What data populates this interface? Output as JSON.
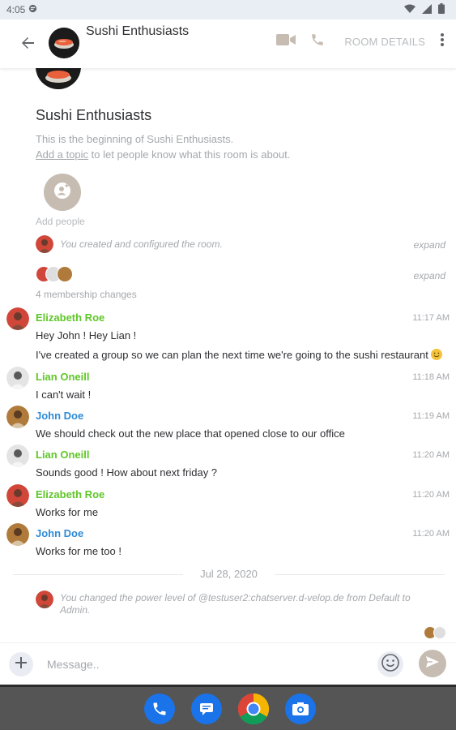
{
  "status_bar": {
    "time": "4:05",
    "icons": [
      "notification-icon",
      "wifi-icon",
      "signal-icon",
      "battery-icon"
    ]
  },
  "header": {
    "room_title": "Sushi Enthusiasts",
    "room_details_label": "ROOM DETAILS",
    "icons": [
      "back-arrow-icon",
      "video-call-icon",
      "voice-call-icon",
      "more-vert-icon"
    ]
  },
  "intro": {
    "room_name": "Sushi Enthusiasts",
    "beginning_text": "This is the beginning of Sushi Enthusiasts.",
    "add_topic_link": "Add a topic",
    "add_topic_rest": " to let people know what this room is about.",
    "add_people_label": "Add people"
  },
  "events": {
    "created": {
      "text": "You created and configured the room.",
      "expand_label": "expand"
    },
    "membership": {
      "count_label": "4 membership changes",
      "expand_label": "expand"
    }
  },
  "messages": [
    {
      "sender": "Elizabeth Roe",
      "time": "11:17 AM",
      "sender_color": "#5fc728",
      "lines": [
        "Hey John ! Hey Lian !",
        "I've created a group so we can plan the next time we're going to the sushi restaurant"
      ]
    },
    {
      "sender": "Lian Oneill",
      "time": "11:18 AM",
      "sender_color": "#5fc728",
      "lines": [
        "I can't wait !"
      ]
    },
    {
      "sender": "John Doe",
      "time": "11:19 AM",
      "sender_color": "#2f8bd6",
      "lines": [
        "We should check out the new place that opened close to our office"
      ]
    },
    {
      "sender": "Lian Oneill",
      "time": "11:20 AM",
      "sender_color": "#5fc728",
      "lines": [
        "Sounds good ! How about next friday ?"
      ]
    },
    {
      "sender": "Elizabeth Roe",
      "time": "11:20 AM",
      "sender_color": "#5fc728",
      "lines": [
        "Works for me"
      ]
    },
    {
      "sender": "John Doe",
      "time": "11:20 AM",
      "sender_color": "#2f8bd6",
      "lines": [
        "Works for me too !"
      ]
    }
  ],
  "date_separator": "Jul 28, 2020",
  "power_event": "You changed the power level of @testuser2:chatserver.d-velop.de from Default to Admin.",
  "composer": {
    "placeholder": "Message.."
  },
  "dock": [
    "phone-app-icon",
    "messages-app-icon",
    "chrome-app-icon",
    "camera-app-icon"
  ],
  "colors": {
    "accent": "#c6bcb2",
    "green_sender": "#5fc728",
    "blue_sender": "#2f8bd6",
    "muted_text": "#a5a8ac",
    "status_bar_bg": "#e9eef5",
    "navbar_bg": "#555555"
  }
}
